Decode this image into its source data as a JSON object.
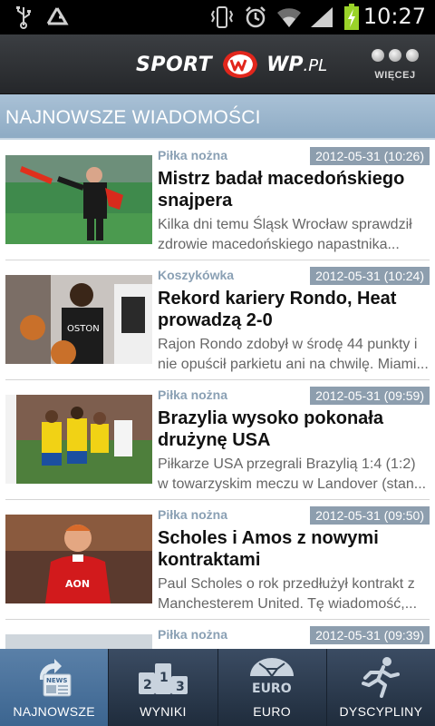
{
  "status_bar": {
    "time": "10:27",
    "icons": [
      "usb-icon",
      "recycle-icon",
      "vibrate-icon",
      "alarm-icon",
      "wifi-icon",
      "signal-icon",
      "battery-charging-icon"
    ]
  },
  "header": {
    "logo_left": "SPORT",
    "logo_right": "WP",
    "logo_suffix": ".PL",
    "more_label": "WIĘCEJ"
  },
  "section": {
    "title": "NAJNOWSZE WIADOMOŚCI"
  },
  "articles": [
    {
      "category": "Piłka nożna",
      "date": "2012-05-31 (10:26)",
      "title": "Mistrz badał macedońskiego snajpera",
      "lead": "Kilka dni temu Śląsk Wrocław sprawdził zdrowie macedońskiego napastnika..."
    },
    {
      "category": "Koszykówka",
      "date": "2012-05-31 (10:24)",
      "title": "Rekord kariery Rondo, Heat prowadzą 2-0",
      "lead": "Rajon Rondo zdobył w środę 44 punkty i nie opuścił parkietu ani na chwilę. Miami..."
    },
    {
      "category": "Piłka nożna",
      "date": "2012-05-31 (09:59)",
      "title": "Brazylia wysoko pokonała drużynę USA",
      "lead": "Piłkarze USA przegrali Brazylią 1:4 (1:2) w towarzyskim meczu w Landover (stan..."
    },
    {
      "category": "Piłka nożna",
      "date": "2012-05-31 (09:50)",
      "title": "Scholes i Amos z nowymi kontraktami",
      "lead": "Paul Scholes o rok przedłużył kontrakt z Manchesterem United. Tę wiadomość,..."
    },
    {
      "category": "Piłka nożna",
      "date": "2012-05-31 (09:39)",
      "title": "",
      "lead": ""
    }
  ],
  "tabs": [
    {
      "label": "NAJNOWSZE",
      "icon": "news-icon",
      "active": true
    },
    {
      "label": "WYNIKI",
      "icon": "podium-icon",
      "active": false
    },
    {
      "label": "EURO",
      "icon": "euro-ball-icon",
      "active": false
    },
    {
      "label": "DYSCYPLINY",
      "icon": "runner-icon",
      "active": false
    }
  ],
  "colors": {
    "section_bg": "#9db7ce",
    "category": "#8aa0b4",
    "date_badge": "#8d9eae",
    "active_tab": "#4b74a0",
    "logo_red": "#e1261c"
  }
}
